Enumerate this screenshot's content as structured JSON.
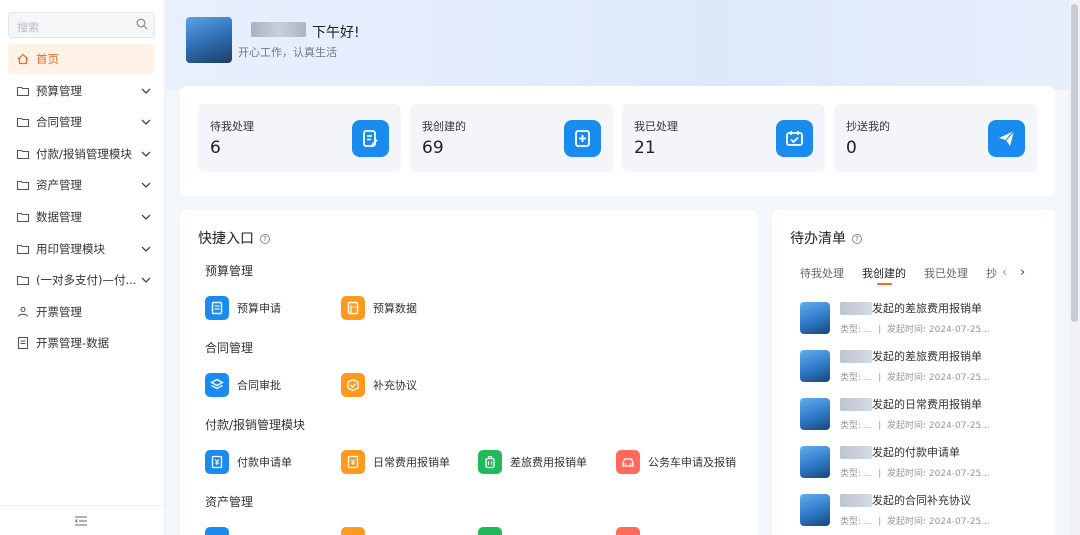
{
  "sidebar": {
    "search_placeholder": "搜索",
    "items": [
      {
        "label": "首页",
        "icon": "home-icon",
        "active": true,
        "expandable": false
      },
      {
        "label": "预算管理",
        "icon": "folder-icon",
        "expandable": true
      },
      {
        "label": "合同管理",
        "icon": "folder-icon",
        "expandable": true
      },
      {
        "label": "付款/报销管理模块",
        "icon": "folder-icon",
        "expandable": true
      },
      {
        "label": "资产管理",
        "icon": "folder-icon",
        "expandable": true
      },
      {
        "label": "数据管理",
        "icon": "folder-icon",
        "expandable": true
      },
      {
        "label": "用印管理模块",
        "icon": "folder-icon",
        "expandable": true
      },
      {
        "label": "(一对多支付)—付...",
        "icon": "folder-icon",
        "expandable": true
      },
      {
        "label": "开票管理",
        "icon": "users-icon",
        "expandable": false
      },
      {
        "label": "开票管理-数据",
        "icon": "document-icon",
        "expandable": false
      }
    ]
  },
  "header": {
    "greeting": "下午好!",
    "motto": "开心工作，认真生活"
  },
  "stats": [
    {
      "label": "待我处理",
      "value": "6",
      "icon": "edit-document-icon"
    },
    {
      "label": "我创建的",
      "value": "69",
      "icon": "add-document-icon"
    },
    {
      "label": "我已处理",
      "value": "21",
      "icon": "calendar-check-icon"
    },
    {
      "label": "抄送我的",
      "value": "0",
      "icon": "send-icon"
    }
  ],
  "quick": {
    "title": "快捷入口",
    "sections": [
      {
        "name": "预算管理",
        "items": [
          {
            "label": "预算申请",
            "color": "#1a8cf0",
            "icon": "document-icon"
          },
          {
            "label": "预算数据",
            "color": "#ff9a1f",
            "icon": "book-icon"
          }
        ]
      },
      {
        "name": "合同管理",
        "items": [
          {
            "label": "合同审批",
            "color": "#1a8cf0",
            "icon": "layers-icon"
          },
          {
            "label": "补充协议",
            "color": "#ff9a1f",
            "icon": "cube-icon"
          }
        ]
      },
      {
        "name": "付款/报销管理模块",
        "items": [
          {
            "label": "付款申请单",
            "color": "#1a8cf0",
            "icon": "receipt-icon"
          },
          {
            "label": "日常费用报销单",
            "color": "#ff9a1f",
            "icon": "receipt-icon"
          },
          {
            "label": "差旅费用报销单",
            "color": "#22b85b",
            "icon": "luggage-icon"
          },
          {
            "label": "公务车申请及报销",
            "color": "#ff6a5a",
            "icon": "car-icon"
          }
        ]
      },
      {
        "name": "资产管理",
        "items": []
      }
    ]
  },
  "todo": {
    "title": "待办清单",
    "tabs": [
      "待我处理",
      "我创建的",
      "我已处理",
      "抄"
    ],
    "active_tab": 1,
    "items": [
      {
        "title": "发起的差旅费用报销单",
        "type": "类型: ...",
        "time": "发起时间: 2024-07-25..."
      },
      {
        "title": "发起的差旅费用报销单",
        "type": "类型: ...",
        "time": "发起时间: 2024-07-25..."
      },
      {
        "title": "发起的日常费用报销单",
        "type": "类型: ...",
        "time": "发起时间: 2024-07-25..."
      },
      {
        "title": "发起的付款申请单",
        "type": "类型: ...",
        "time": "发起时间: 2024-07-25..."
      },
      {
        "title": "发起的合同补充协议",
        "type": "类型: ...",
        "time": "发起时间: 2024-07-25..."
      }
    ]
  }
}
